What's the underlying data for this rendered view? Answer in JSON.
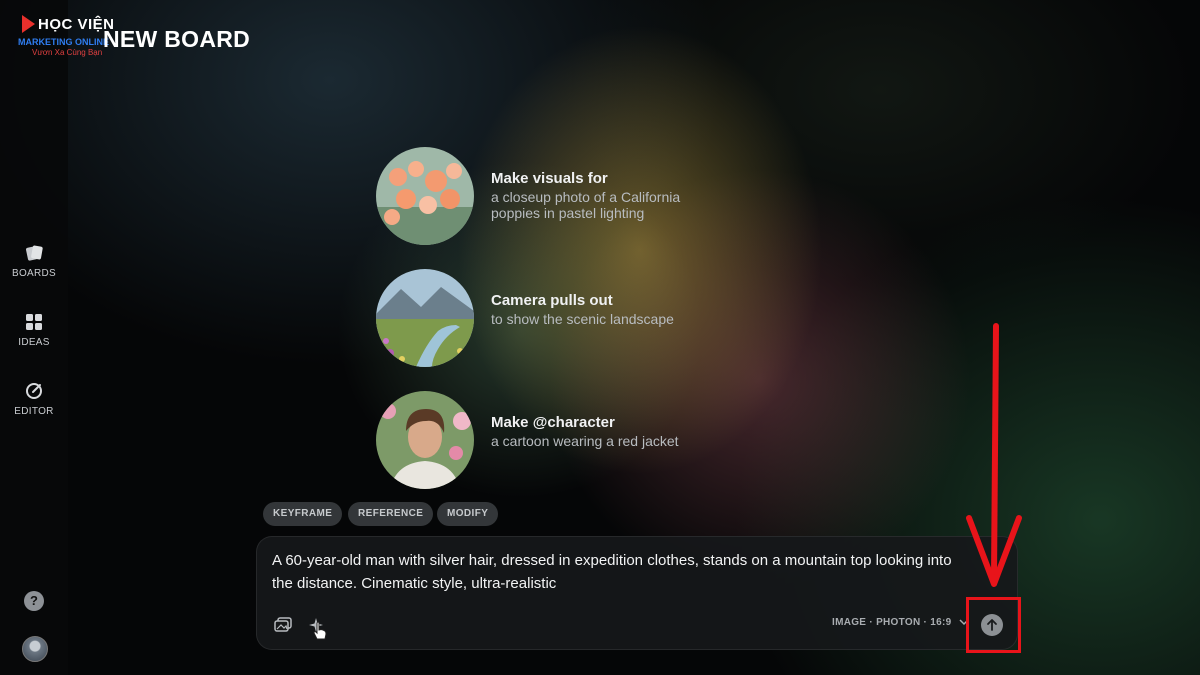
{
  "brand": {
    "top": "HỌC VIỆN",
    "middle": "MARKETING ONLINE",
    "tagline": "Vươn Xa Cùng Bạn"
  },
  "header": {
    "title": "NEW BOARD"
  },
  "sidebar": {
    "items": [
      {
        "label": "BOARDS",
        "icon": "boards-icon"
      },
      {
        "label": "IDEAS",
        "icon": "ideas-icon"
      },
      {
        "label": "EDITOR",
        "icon": "editor-icon"
      }
    ],
    "help": "?"
  },
  "suggestions": [
    {
      "title": "Make visuals for",
      "description": "a closeup photo of a California poppies in pastel lighting",
      "thumbnail": "poppies-photo"
    },
    {
      "title": "Camera pulls out",
      "description": "to show the scenic landscape",
      "thumbnail": "landscape-photo"
    },
    {
      "title": "Make @character",
      "description": "a cartoon wearing a red jacket",
      "thumbnail": "character-photo"
    }
  ],
  "chips": [
    "KEYFRAME",
    "REFERENCE",
    "MODIFY"
  ],
  "composer": {
    "prompt": "A 60-year-old man with silver hair, dressed in expedition clothes, stands on a mountain top looking into the distance. Cinematic style, ultra-realistic",
    "settings": "IMAGE · PHOTON · 16:9"
  },
  "colors": {
    "annotation": "#e8141a",
    "logo_blue": "#2f7df0",
    "logo_red": "#e04040"
  }
}
